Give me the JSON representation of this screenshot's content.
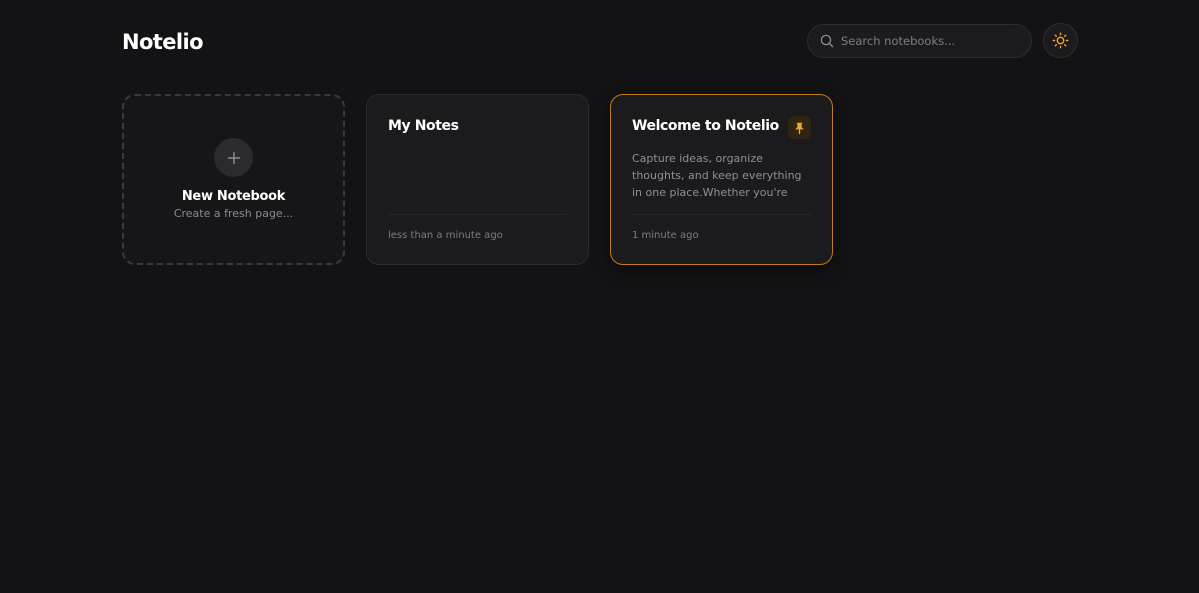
{
  "app": {
    "logo": "Notelio"
  },
  "header": {
    "search": {
      "placeholder": "Search notebooks...",
      "value": "",
      "icon": "search-icon"
    },
    "theme_toggle": {
      "icon": "sun-icon"
    }
  },
  "new_notebook": {
    "icon": "plus-icon",
    "title": "New Notebook",
    "subtitle": "Create a fresh page..."
  },
  "notebooks": [
    {
      "title": "My Notes",
      "preview": "",
      "time": "less than a minute ago",
      "pinned": false
    },
    {
      "title": "Welcome to Notelio",
      "preview": "Capture ideas, organize thoughts, and keep everything in one place.Whether you're taking class...",
      "time": "1 minute ago",
      "pinned": true,
      "pin_icon": "pin-icon"
    }
  ],
  "colors": {
    "background": "#131315",
    "card": "#1b1b1e",
    "accent": "#f5a524",
    "pinned_border": "#c07a16"
  }
}
